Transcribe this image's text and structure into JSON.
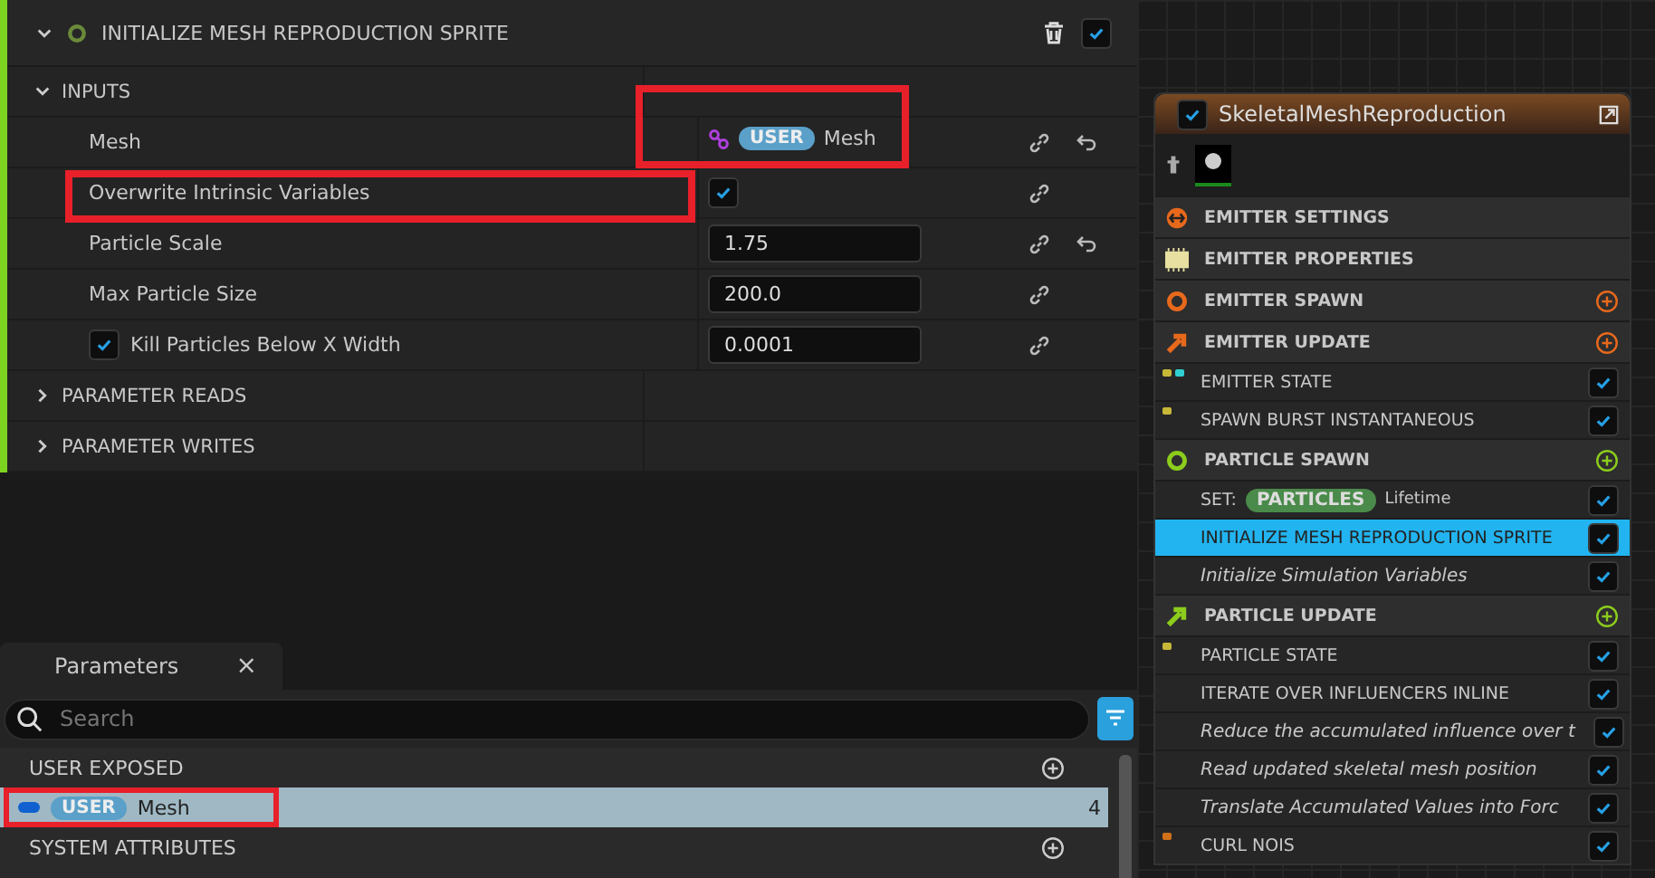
{
  "module_panel": {
    "title": "INITIALIZE MESH REPRODUCTION SPRITE",
    "enabled": true,
    "sections": [
      {
        "label": "INPUTS",
        "expanded": true,
        "inputs": [
          {
            "kind": "binding",
            "label": "Mesh",
            "namespace": "USER",
            "value": "Mesh",
            "annotated": true,
            "reset": true
          },
          {
            "kind": "checkbox",
            "label": "Overwrite Intrinsic Variables",
            "checked": true,
            "annotated": true,
            "reset": false
          },
          {
            "kind": "number",
            "label": "Particle Scale",
            "value": "1.75",
            "reset": true
          },
          {
            "kind": "number",
            "label": "Max Particle Size",
            "value": "200.0",
            "reset": false
          },
          {
            "kind": "number",
            "label": "Kill Particles Below X Width",
            "value": "0.0001",
            "reset": false,
            "enabled": true
          }
        ]
      },
      {
        "label": "PARAMETER READS",
        "expanded": false
      },
      {
        "label": "PARAMETER WRITES",
        "expanded": false
      }
    ]
  },
  "parameters_panel": {
    "tab": "Parameters",
    "close": "×",
    "search": {
      "placeholder": "Search"
    },
    "groups": [
      {
        "label": "USER EXPOSED",
        "items": [
          {
            "namespace": "USER",
            "name": "Mesh",
            "count": "4",
            "selected": true,
            "annotated": true
          }
        ]
      },
      {
        "label": "SYSTEM ATTRIBUTES"
      }
    ]
  },
  "emitter_node": {
    "title": "SkeletalMeshReproduction",
    "enabled": true,
    "rows": [
      {
        "kind": "settings",
        "label": "EMITTER SETTINGS",
        "color": "#e8691c"
      },
      {
        "kind": "properties",
        "label": "EMITTER PROPERTIES",
        "color": "#e8e0a0"
      },
      {
        "kind": "spawn",
        "label": "EMITTER SPAWN",
        "color": "#e8691c",
        "add": true
      },
      {
        "kind": "update",
        "label": "EMITTER UPDATE",
        "color": "#e8691c",
        "add": true
      },
      {
        "kind": "module",
        "label": "EMITTER STATE",
        "italic": false,
        "checked": true,
        "selected": false,
        "dots": [
          {
            "color": "#c8b838"
          },
          {
            "color": "#30d0d0"
          }
        ]
      },
      {
        "kind": "module",
        "label": "SPAWN BURST INSTANTANEOUS",
        "italic": false,
        "checked": true,
        "selected": false,
        "dots": [
          {
            "color": "#c8b838"
          }
        ]
      },
      {
        "kind": "spawn",
        "label": "PARTICLE SPAWN",
        "color": "#8ccc1c",
        "add": true
      },
      {
        "kind": "set",
        "prefix": "SET:",
        "pill": "PARTICLES",
        "label": "Lifetime",
        "checked": true,
        "selected": false
      },
      {
        "kind": "module",
        "label": "INITIALIZE MESH REPRODUCTION SPRITE",
        "italic": false,
        "checked": true,
        "selected": true
      },
      {
        "kind": "module",
        "label": "Initialize Simulation Variables",
        "italic": true,
        "checked": true,
        "selected": false
      },
      {
        "kind": "update",
        "label": "PARTICLE UPDATE",
        "color": "#8ccc1c",
        "add": true
      },
      {
        "kind": "module",
        "label": "PARTICLE STATE",
        "italic": false,
        "checked": true,
        "selected": false,
        "dots": [
          {
            "color": "#c8b838"
          }
        ]
      },
      {
        "kind": "module",
        "label": "ITERATE OVER INFLUENCERS INLINE",
        "italic": false,
        "checked": true,
        "selected": false
      },
      {
        "kind": "module",
        "label": "Reduce the accumulated influence over t",
        "italic": true,
        "checked": true,
        "selected": false
      },
      {
        "kind": "module",
        "label": "Read updated skeletal mesh position",
        "italic": true,
        "checked": true,
        "selected": false
      },
      {
        "kind": "module",
        "label": "Translate Accumulated Values into Forc",
        "italic": true,
        "checked": true,
        "selected": false
      },
      {
        "kind": "module",
        "label": "CURL NOIS",
        "italic": false,
        "checked": true,
        "selected": false,
        "dots": [
          {
            "color": "#d07018"
          }
        ]
      }
    ]
  }
}
